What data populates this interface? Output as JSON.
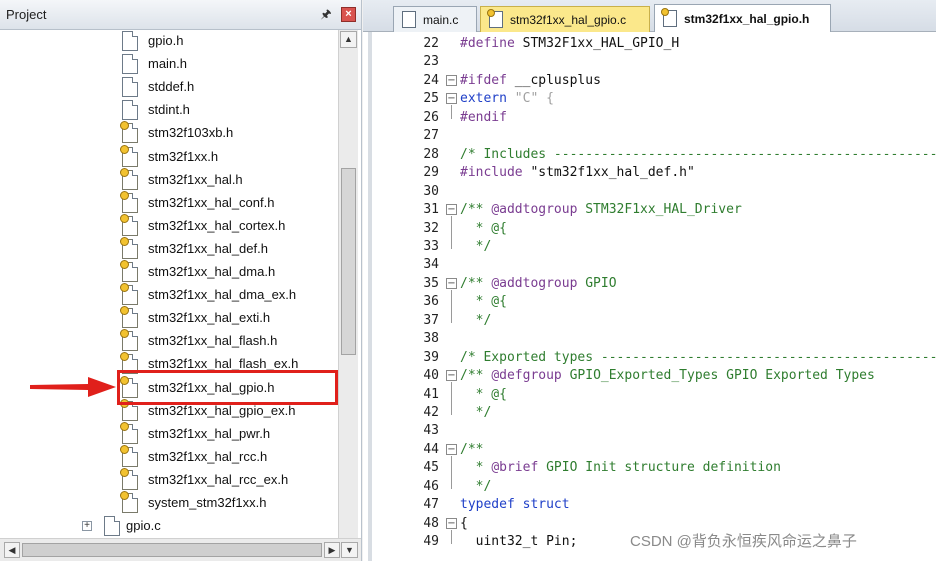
{
  "project_panel": {
    "title": "Project",
    "pin_glyph": "ᵖ",
    "close_glyph": "×",
    "scroll_up": "▲",
    "scroll_left": "◀",
    "scroll_right": "▶",
    "scroll_down": "▼",
    "expand_glyph": "+",
    "files": [
      "gpio.h",
      "main.h",
      "stddef.h",
      "stdint.h",
      "stm32f103xb.h",
      "stm32f1xx.h",
      "stm32f1xx_hal.h",
      "stm32f1xx_hal_conf.h",
      "stm32f1xx_hal_cortex.h",
      "stm32f1xx_hal_def.h",
      "stm32f1xx_hal_dma.h",
      "stm32f1xx_hal_dma_ex.h",
      "stm32f1xx_hal_exti.h",
      "stm32f1xx_hal_flash.h",
      "stm32f1xx_hal_flash_ex.h",
      "stm32f1xx_hal_gpio.h",
      "stm32f1xx_hal_gpio_ex.h",
      "stm32f1xx_hal_pwr.h",
      "stm32f1xx_hal_rcc.h",
      "stm32f1xx_hal_rcc_ex.h",
      "system_stm32f1xx.h"
    ],
    "group": "gpio.c",
    "highlighted_file": "stm32f1xx_hal_gpio.h"
  },
  "tabs": [
    {
      "label": "main.c"
    },
    {
      "label": "stm32f1xx_hal_gpio.c"
    },
    {
      "label": "stm32f1xx_hal_gpio.h"
    }
  ],
  "editor": {
    "lines": [
      {
        "n": "22",
        "t": "#define STM32F1xx_HAL_GPIO_H"
      },
      {
        "n": "23",
        "t": ""
      },
      {
        "n": "24",
        "t": "#ifdef __cplusplus"
      },
      {
        "n": "25",
        "t": "extern \"C\" {"
      },
      {
        "n": "26",
        "t": "#endif"
      },
      {
        "n": "27",
        "t": ""
      },
      {
        "n": "28",
        "t": "/* Includes ------------------------------------------------------------------"
      },
      {
        "n": "29",
        "t": "#include \"stm32f1xx_hal_def.h\""
      },
      {
        "n": "30",
        "t": ""
      },
      {
        "n": "31",
        "t": "/** @addtogroup STM32F1xx_HAL_Driver"
      },
      {
        "n": "32",
        "t": "  * @{"
      },
      {
        "n": "33",
        "t": "  */"
      },
      {
        "n": "34",
        "t": ""
      },
      {
        "n": "35",
        "t": "/** @addtogroup GPIO"
      },
      {
        "n": "36",
        "t": "  * @{"
      },
      {
        "n": "37",
        "t": "  */"
      },
      {
        "n": "38",
        "t": ""
      },
      {
        "n": "39",
        "t": "/* Exported types ------------------------------------------------------------"
      },
      {
        "n": "40",
        "t": "/** @defgroup GPIO_Exported_Types GPIO Exported Types"
      },
      {
        "n": "41",
        "t": "  * @{"
      },
      {
        "n": "42",
        "t": "  */"
      },
      {
        "n": "43",
        "t": ""
      },
      {
        "n": "44",
        "t": "/**"
      },
      {
        "n": "45",
        "t": "  * @brief GPIO Init structure definition"
      },
      {
        "n": "46",
        "t": "  */"
      },
      {
        "n": "47",
        "t": "typedef struct"
      },
      {
        "n": "48",
        "t": "{"
      },
      {
        "n": "49",
        "t": "  uint32_t Pin;"
      }
    ]
  },
  "watermark": "CSDN @背负永恒疾风命运之鼻子",
  "colors": {
    "highlight": "#e0201b",
    "active_tab": "#fbe88b"
  }
}
